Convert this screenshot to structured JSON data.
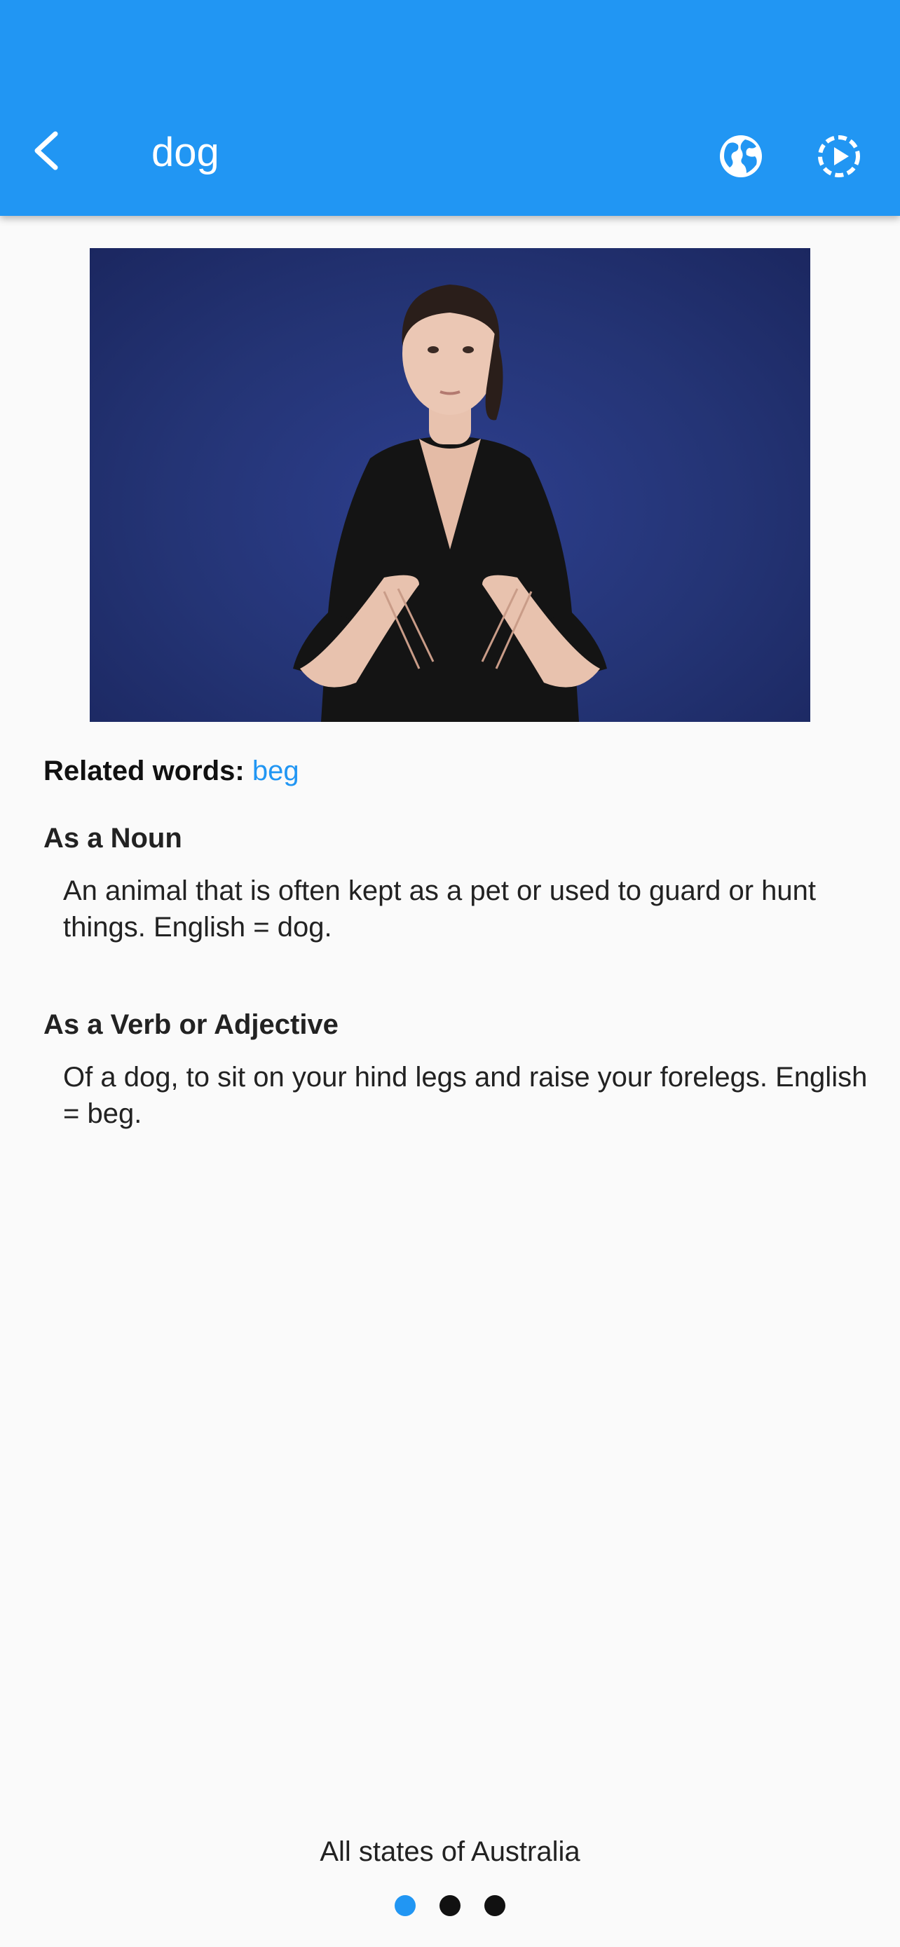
{
  "app_bar": {
    "title": "dog",
    "back_icon": "chevron-left-icon",
    "actions": [
      {
        "icon": "globe-icon"
      },
      {
        "icon": "play-circle-dashed-icon"
      }
    ],
    "color": "#2196f3"
  },
  "video": {
    "description_icon": "sign-language-video"
  },
  "related": {
    "label": "Related words:",
    "words": [
      "beg"
    ]
  },
  "sections": [
    {
      "title": "As a Noun",
      "body": "An animal that is often kept as a pet or used to guard or hunt things. English = dog."
    },
    {
      "title": "As a Verb or Adjective",
      "body": "Of a dog, to sit on your hind legs and raise your forelegs. English = beg."
    }
  ],
  "footer": {
    "region": "All states of Australia",
    "pages": 3,
    "current_page": 1
  },
  "colors": {
    "accent": "#2196f3",
    "background": "#fafafa"
  }
}
